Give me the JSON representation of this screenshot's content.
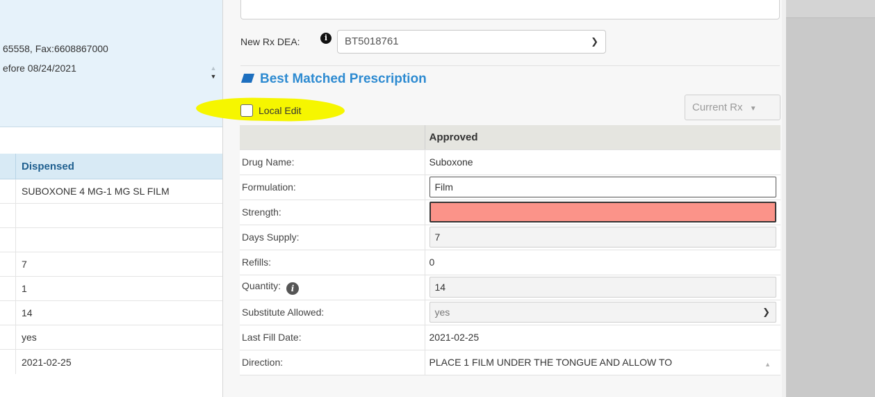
{
  "left_panel": {
    "contact_line": "65558, Fax:6608867000",
    "date_line": "efore 08/24/2021",
    "table_header": "Dispensed",
    "rows": [
      "SUBOXONE 4 MG-1 MG SL FILM",
      "",
      "",
      "7",
      "1",
      "14",
      "yes",
      "2021-02-25"
    ]
  },
  "dea": {
    "label": "New Rx DEA:",
    "value": "BT5018761"
  },
  "section": {
    "title": "Best Matched Prescription"
  },
  "local_edit_label": "Local Edit",
  "current_rx_label": "Current Rx",
  "table": {
    "header": "Approved",
    "drug_name": {
      "label": "Drug Name:",
      "value": "Suboxone"
    },
    "formulation": {
      "label": "Formulation:",
      "value": "Film"
    },
    "strength": {
      "label": "Strength:",
      "value": ""
    },
    "days_supply": {
      "label": "Days Supply:",
      "value": "7"
    },
    "refills": {
      "label": "Refills:",
      "value": "0"
    },
    "quantity": {
      "label": "Quantity:",
      "value": "14"
    },
    "substitute": {
      "label": "Substitute Allowed:",
      "value": "yes"
    },
    "last_fill": {
      "label": "Last Fill Date:",
      "value": "2021-02-25"
    },
    "direction": {
      "label": "Direction:",
      "value": "PLACE 1 FILM UNDER THE TONGUE AND ALLOW TO"
    }
  },
  "colors": {
    "accent": "#2e8bd1",
    "error_field": "#fb9389",
    "highlight": "#f6f600"
  }
}
